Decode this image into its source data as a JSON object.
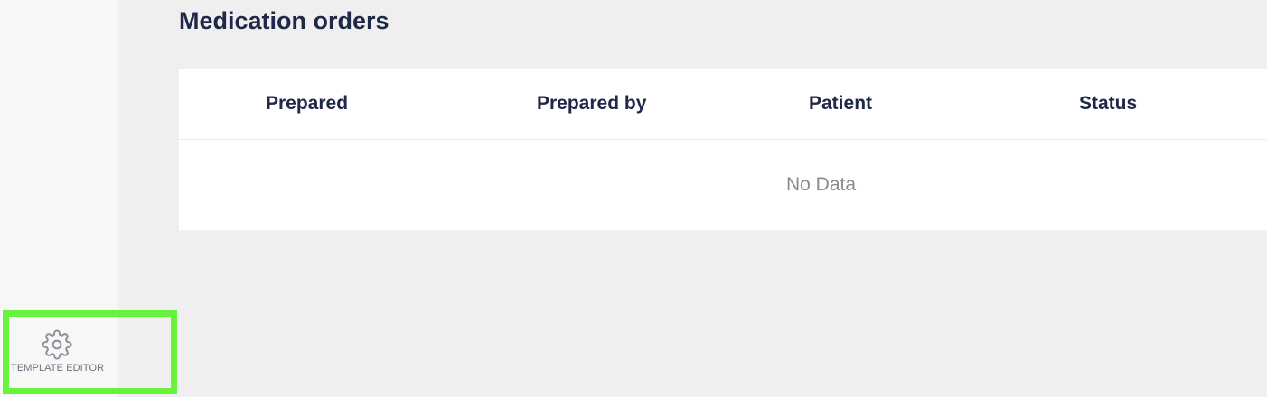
{
  "sidebar": {
    "template_editor": {
      "label": "TEMPLATE EDITOR",
      "icon": "gear-icon"
    }
  },
  "main": {
    "title": "Medication orders",
    "table": {
      "columns": [
        "Prepared",
        "Prepared by",
        "Patient",
        "Status"
      ],
      "rows": [],
      "empty_text": "No Data"
    }
  },
  "colors": {
    "page_background": "#efefef",
    "sidebar_background": "#f7f7f7",
    "title_text": "#202849",
    "muted_text": "#8a8a8a",
    "highlight": "#66f23d"
  }
}
